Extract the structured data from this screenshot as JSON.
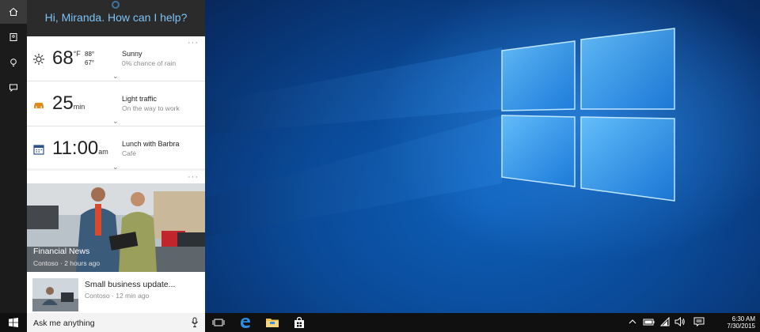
{
  "cortana": {
    "greeting": "Hi, Miranda. How can I help?",
    "more": "···",
    "weather": {
      "temp": "68",
      "unit": "°F",
      "high": "88°",
      "low": "67°",
      "condition": "Sunny",
      "detail": "0% chance of rain"
    },
    "traffic": {
      "value": "25",
      "unit": "min",
      "title": "Light traffic",
      "detail": "On the way to work"
    },
    "calendar": {
      "time": "11:00",
      "ampm": "am",
      "title": "Lunch with Barbra",
      "detail": "Café"
    },
    "news": [
      {
        "title": "Financial News",
        "meta": "Contoso · 2 hours ago"
      },
      {
        "title": "Small business update...",
        "meta": "Contoso · 12 min ago"
      }
    ]
  },
  "taskbar": {
    "ask_placeholder": "Ask me anything",
    "time": "6:30 AM",
    "date": "7/30/2015"
  },
  "icons": {
    "start": "windows-start-icon",
    "task_view": "task-view-icon",
    "edge": "edge-browser-icon",
    "explorer": "file-explorer-icon",
    "store": "store-icon",
    "tray": [
      "chevron-up-icon",
      "battery-icon",
      "network-icon",
      "volume-icon",
      "action-center-icon"
    ]
  },
  "colors": {
    "accent": "#7cc3f5",
    "taskbar": "#101010",
    "rail": "#1b1b1b"
  }
}
